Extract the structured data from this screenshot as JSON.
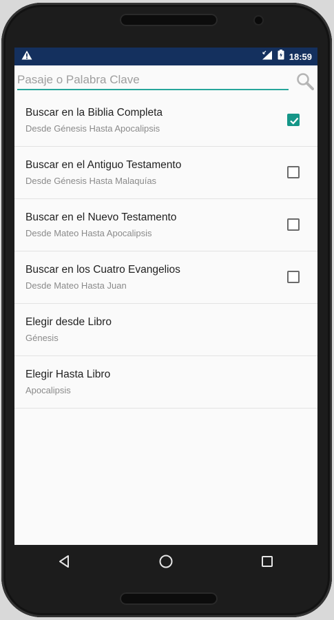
{
  "status_bar": {
    "time": "18:59",
    "warning_icon": "warning-icon",
    "signal_icon": "signal-icon",
    "battery_icon": "battery-icon"
  },
  "search": {
    "placeholder": "Pasaje o Palabra Clave",
    "value": "",
    "icon": "search-icon"
  },
  "options": [
    {
      "title": "Buscar en la Biblia Completa",
      "subtitle": "Desde Génesis Hasta Apocalipsis",
      "checked": true
    },
    {
      "title": "Buscar en el Antiguo Testamento",
      "subtitle": "Desde Génesis Hasta Malaquías",
      "checked": false
    },
    {
      "title": "Buscar en el Nuevo Testamento",
      "subtitle": "Desde Mateo Hasta Apocalipsis",
      "checked": false
    },
    {
      "title": "Buscar en los Cuatro Evangelios",
      "subtitle": "Desde Mateo Hasta Juan",
      "checked": false
    },
    {
      "title": "Elegir desde Libro",
      "subtitle": "Génesis"
    },
    {
      "title": "Elegir Hasta Libro",
      "subtitle": "Apocalipsis"
    }
  ],
  "nav": {
    "back_icon": "back-icon",
    "home_icon": "home-icon",
    "recents_icon": "recents-icon"
  },
  "colors": {
    "status_bar": "#14305e",
    "accent": "#159688",
    "background": "#fafafa"
  }
}
